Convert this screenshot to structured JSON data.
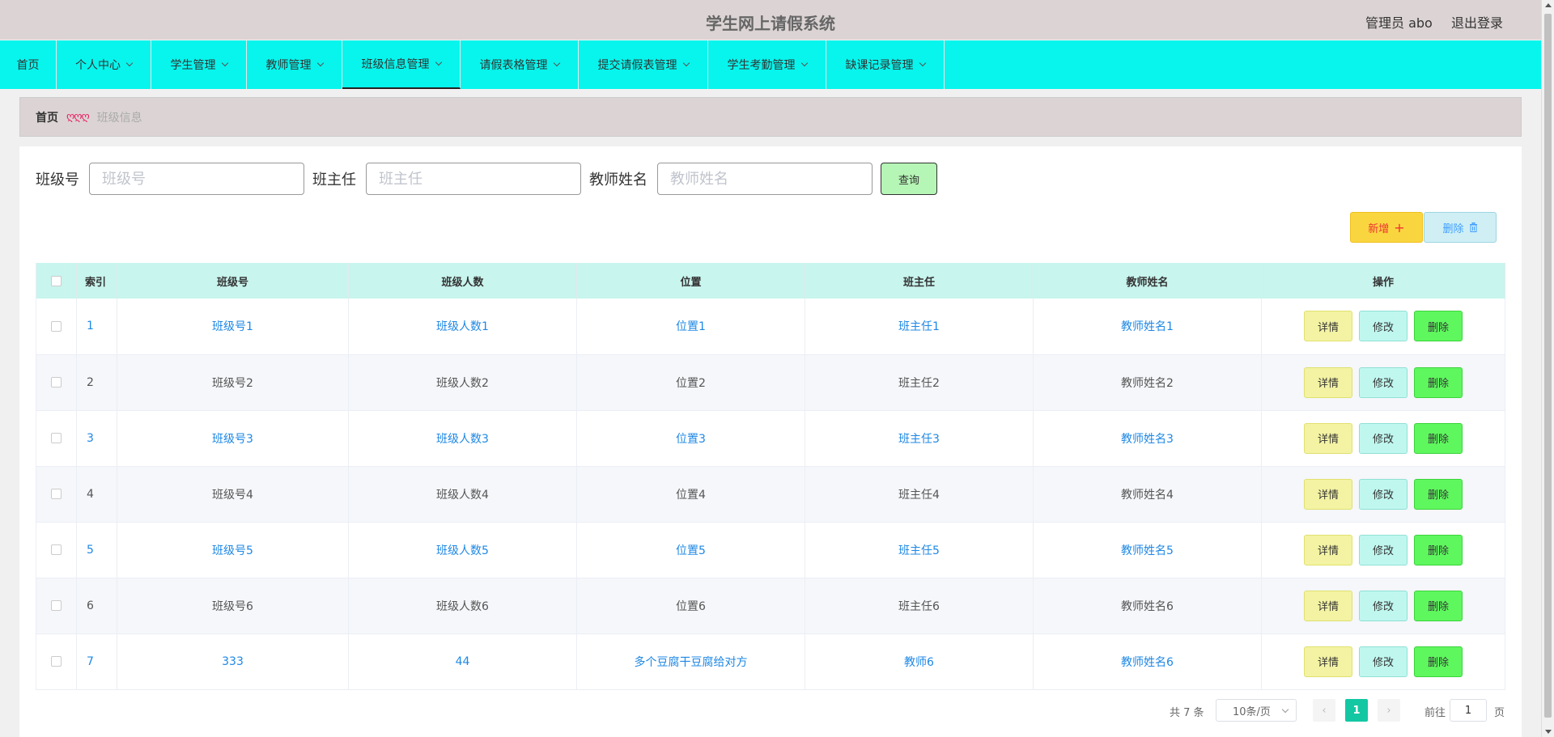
{
  "header": {
    "title": "学生网上请假系统",
    "user": "管理员 abo",
    "logout": "退出登录"
  },
  "nav": {
    "items": [
      {
        "label": "首页",
        "dropdown": false,
        "active": false
      },
      {
        "label": "个人中心",
        "dropdown": true,
        "active": false
      },
      {
        "label": "学生管理",
        "dropdown": true,
        "active": false
      },
      {
        "label": "教师管理",
        "dropdown": true,
        "active": false
      },
      {
        "label": "班级信息管理",
        "dropdown": true,
        "active": true
      },
      {
        "label": "请假表格管理",
        "dropdown": true,
        "active": false
      },
      {
        "label": "提交请假表管理",
        "dropdown": true,
        "active": false
      },
      {
        "label": "学生考勤管理",
        "dropdown": true,
        "active": false
      },
      {
        "label": "缺课记录管理",
        "dropdown": true,
        "active": false
      }
    ]
  },
  "breadcrumb": {
    "home": "首页",
    "separator": "ღღღ",
    "current": "班级信息"
  },
  "search": {
    "class_no_label": "班级号",
    "class_no_placeholder": "班级号",
    "head_teacher_label": "班主任",
    "head_teacher_placeholder": "班主任",
    "teacher_name_label": "教师姓名",
    "teacher_name_placeholder": "教师姓名",
    "query_label": "查询"
  },
  "actions": {
    "add_label": "新增",
    "delete_label": "删除"
  },
  "table": {
    "headers": [
      "索引",
      "班级号",
      "班级人数",
      "位置",
      "班主任",
      "教师姓名",
      "操作"
    ],
    "rows": [
      [
        "1",
        "班级号1",
        "班级人数1",
        "位置1",
        "班主任1",
        "教师姓名1"
      ],
      [
        "2",
        "班级号2",
        "班级人数2",
        "位置2",
        "班主任2",
        "教师姓名2"
      ],
      [
        "3",
        "班级号3",
        "班级人数3",
        "位置3",
        "班主任3",
        "教师姓名3"
      ],
      [
        "4",
        "班级号4",
        "班级人数4",
        "位置4",
        "班主任4",
        "教师姓名4"
      ],
      [
        "5",
        "班级号5",
        "班级人数5",
        "位置5",
        "班主任5",
        "教师姓名5"
      ],
      [
        "6",
        "班级号6",
        "班级人数6",
        "位置6",
        "班主任6",
        "教师姓名6"
      ],
      [
        "7",
        "333",
        "44",
        "多个豆腐干豆腐给对方",
        "教师6",
        "教师姓名6"
      ]
    ],
    "row_actions": {
      "detail": "详情",
      "edit": "修改",
      "remove": "删除"
    }
  },
  "pagination": {
    "total": "共 7 条",
    "page_size": "10条/页",
    "current_page": "1",
    "goto_prefix": "前往",
    "goto_value": "1",
    "goto_suffix": "页"
  },
  "colors": {
    "nav_bg": "#07f5ed",
    "header_bg": "#dcd4d4",
    "table_header_bg": "#c8f5ee",
    "link_blue": "#1e88e5",
    "pager_active": "#13c7a3"
  }
}
